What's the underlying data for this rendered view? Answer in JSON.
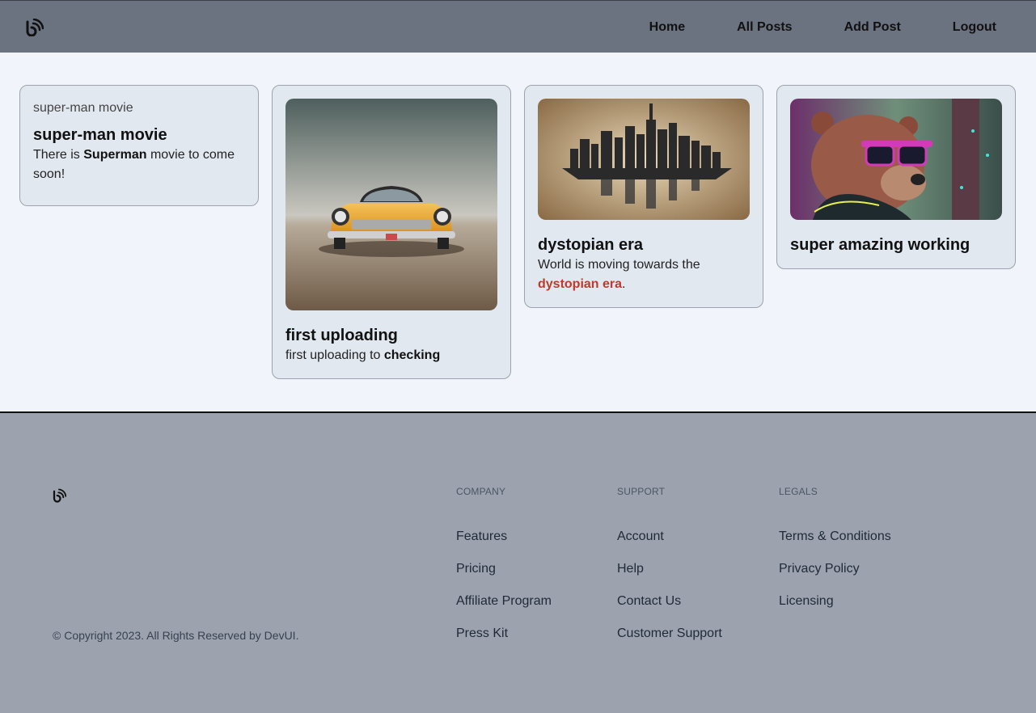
{
  "nav": {
    "logo": "logo-icon",
    "links": [
      "Home",
      "All Posts",
      "Add Post",
      "Logout"
    ]
  },
  "posts": [
    {
      "image_alt": "super-man movie",
      "image_loaded": false,
      "title": "super-man movie",
      "body_pre": "There is ",
      "body_bold": "Superman",
      "body_post": " movie to come soon!"
    },
    {
      "image": "yellow vintage car on sand",
      "title": "first uploading",
      "body_pre": "first uploading to ",
      "body_bold": "checking",
      "body_post": ""
    },
    {
      "image": "dark city skyline sculpture",
      "title": "dystopian era",
      "body_pre": "World is moving towards the ",
      "body_red": "dystopian era",
      "body_post": "."
    },
    {
      "image": "bear with neon sunglasses",
      "title": "super amazing working"
    }
  ],
  "footer": {
    "copyright": "© Copyright 2023. All Rights Reserved by DevUI.",
    "company": {
      "heading": "COMPANY",
      "links": [
        "Features",
        "Pricing",
        "Affiliate Program",
        "Press Kit"
      ]
    },
    "support": {
      "heading": "SUPPORT",
      "links": [
        "Account",
        "Help",
        "Contact Us",
        "Customer Support"
      ]
    },
    "legals": {
      "heading": "LEGALS",
      "links": [
        "Terms & Conditions",
        "Privacy Policy",
        "Licensing"
      ]
    }
  },
  "colors": {
    "nav_bg": "#6b7280",
    "page_bg": "#f1f5fb",
    "card_bg": "#e2e8f0",
    "footer_bg": "#9ca3af",
    "accent_red": "#c0392b"
  }
}
